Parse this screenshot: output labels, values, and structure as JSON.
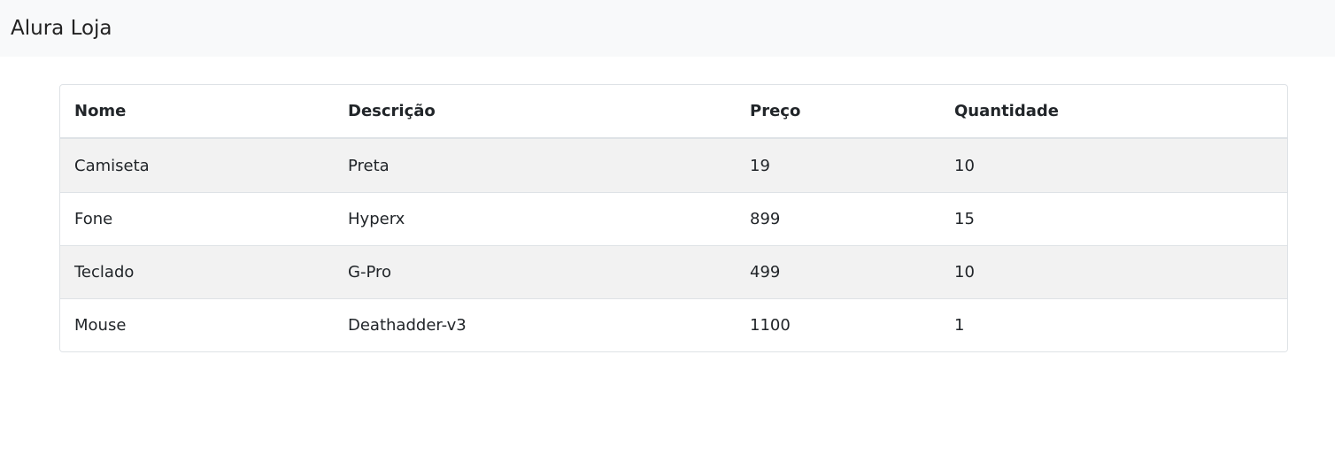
{
  "navbar": {
    "brand": "Alura Loja"
  },
  "table": {
    "headers": [
      "Nome",
      "Descrição",
      "Preço",
      "Quantidade"
    ],
    "rows": [
      [
        "Camiseta",
        "Preta",
        "19",
        "10"
      ],
      [
        "Fone",
        "Hyperx",
        "899",
        "15"
      ],
      [
        "Teclado",
        "G-Pro",
        "499",
        "10"
      ],
      [
        "Mouse",
        "Deathadder-v3",
        "1100",
        "1"
      ]
    ]
  }
}
